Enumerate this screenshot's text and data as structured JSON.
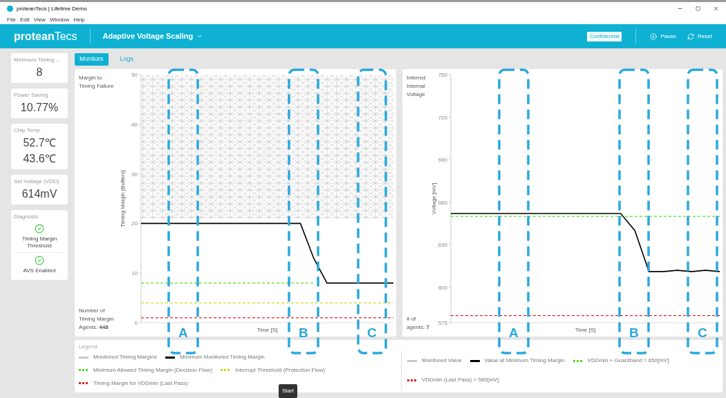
{
  "window": {
    "title": "proteanTecs | Lifetime Demo"
  },
  "menu": [
    "File",
    "Edit",
    "View",
    "Window",
    "Help"
  ],
  "header": {
    "logo_bold": "protean",
    "logo_light": "Tecs",
    "title": "Adaptive Voltage Scaling",
    "badge": "Confidential",
    "actions": [
      {
        "label": "Pause",
        "kind": "pause"
      },
      {
        "label": "Reset",
        "kind": "reset"
      }
    ]
  },
  "sidebar": [
    {
      "kind": "value",
      "title": "Minimum Timing ...",
      "values": [
        "8"
      ]
    },
    {
      "kind": "value",
      "title": "Power Saving",
      "values": [
        "10.77%"
      ]
    },
    {
      "kind": "value",
      "title": "Chip Temp",
      "values": [
        "52.7℃",
        "43.6℃"
      ]
    },
    {
      "kind": "value",
      "title": "Set Voltage (VDD)",
      "values": [
        "614mV"
      ]
    },
    {
      "kind": "diagnosis",
      "title": "Diagnosis",
      "items": [
        {
          "label": "Timing Margin Threshold",
          "ok": true
        },
        {
          "label": "AVS Enabled",
          "ok": true
        }
      ]
    }
  ],
  "tabs": [
    {
      "label": "Monitors",
      "selected": true
    },
    {
      "label": "Logs",
      "selected": false
    }
  ],
  "charts": [
    {
      "title": "Margin to Timing Failure",
      "footer": "Number of Timing Margin Agents: **448**",
      "monitored": {
        "label": "Monitored Timing Margins",
        "color": "#c8c8c8"
      },
      "chart_data": {
        "type": "line",
        "xlabel": "Time [S]",
        "ylabel": "Timing Margin [Buffers]",
        "ylim": [
          0,
          50
        ],
        "yticks": [
          0,
          10,
          20,
          30,
          40,
          50
        ],
        "bands": [
          {
            "axis": "y",
            "from": 21,
            "to": 50,
            "color": "#c8c8c8"
          }
        ],
        "series": [
          {
            "name": "Minimum Monitored Timing Margin",
            "color": "#000000",
            "line_style": "solid",
            "values": [
              20,
              20,
              20,
              20,
              20,
              20,
              20,
              20,
              20,
              20,
              20,
              20,
              20,
              13,
              8,
              8,
              8,
              8,
              8,
              8
            ]
          },
          {
            "name": "Minimum Allowed Timing Margin (Decision Flow)",
            "color": "#55dd22",
            "line_style": "dashed",
            "values": [
              8,
              8,
              8,
              8,
              8,
              8,
              8,
              8,
              8,
              8,
              8,
              8,
              8,
              8,
              null,
              null,
              null,
              null,
              null,
              null
            ]
          },
          {
            "name": "Interrupt Threshold (Protection Flow)",
            "color": "#d4d41a",
            "line_style": "dashed",
            "values": [
              4,
              4,
              4,
              4,
              4,
              4,
              4,
              4,
              4,
              4,
              4,
              4,
              4,
              4,
              4,
              4,
              4,
              4,
              4,
              4
            ]
          },
          {
            "name": "Timing Margin for VDDmin (Last Pass)",
            "color": "#dd2222",
            "line_style": "dashed",
            "values": [
              1,
              1,
              1,
              1,
              1,
              1,
              1,
              1,
              1,
              1,
              1,
              1,
              1,
              1,
              1,
              1,
              1,
              1,
              1,
              1
            ]
          }
        ]
      }
    },
    {
      "title": "Inferred Internal Voltage",
      "footer": "# of agents: **7**",
      "monitored": {
        "label": "Monitored Value",
        "color": "#c8c8c8"
      },
      "chart_data": {
        "type": "line",
        "xlabel": "Time [S]",
        "ylabel": "Voltage [mV]",
        "ylim": [
          575,
          750
        ],
        "yticks": [
          575,
          600,
          630,
          660,
          690,
          720,
          750
        ],
        "series": [
          {
            "name": "Value at Minimum Timing Margin",
            "color": "#000000",
            "line_style": "solid",
            "values": [
              652,
              652,
              652,
              652,
              652,
              652,
              652,
              652,
              652,
              652,
              652,
              652,
              652,
              640,
              611,
              611,
              612,
              611,
              612,
              611
            ]
          },
          {
            "name": "VDDmin + Guardband = 650[mV]",
            "color": "#55dd22",
            "line_style": "dashed",
            "values": [
              650,
              650,
              650,
              650,
              650,
              650,
              650,
              650,
              650,
              650,
              650,
              650,
              650,
              650,
              650,
              650,
              650,
              650,
              650,
              650
            ]
          },
          {
            "name": "VDDmin (Last Pass) = 580[mV]",
            "color": "#dd2222",
            "line_style": "dashed",
            "values": [
              580,
              580,
              580,
              580,
              580,
              580,
              580,
              580,
              580,
              580,
              580,
              580,
              580,
              580,
              580,
              580,
              580,
              580,
              580,
              580
            ]
          }
        ]
      }
    }
  ],
  "legend": {
    "title": "Legend"
  },
  "highlights": [
    "A",
    "B",
    "C",
    "A",
    "B",
    "C"
  ],
  "tooltip": "Start"
}
